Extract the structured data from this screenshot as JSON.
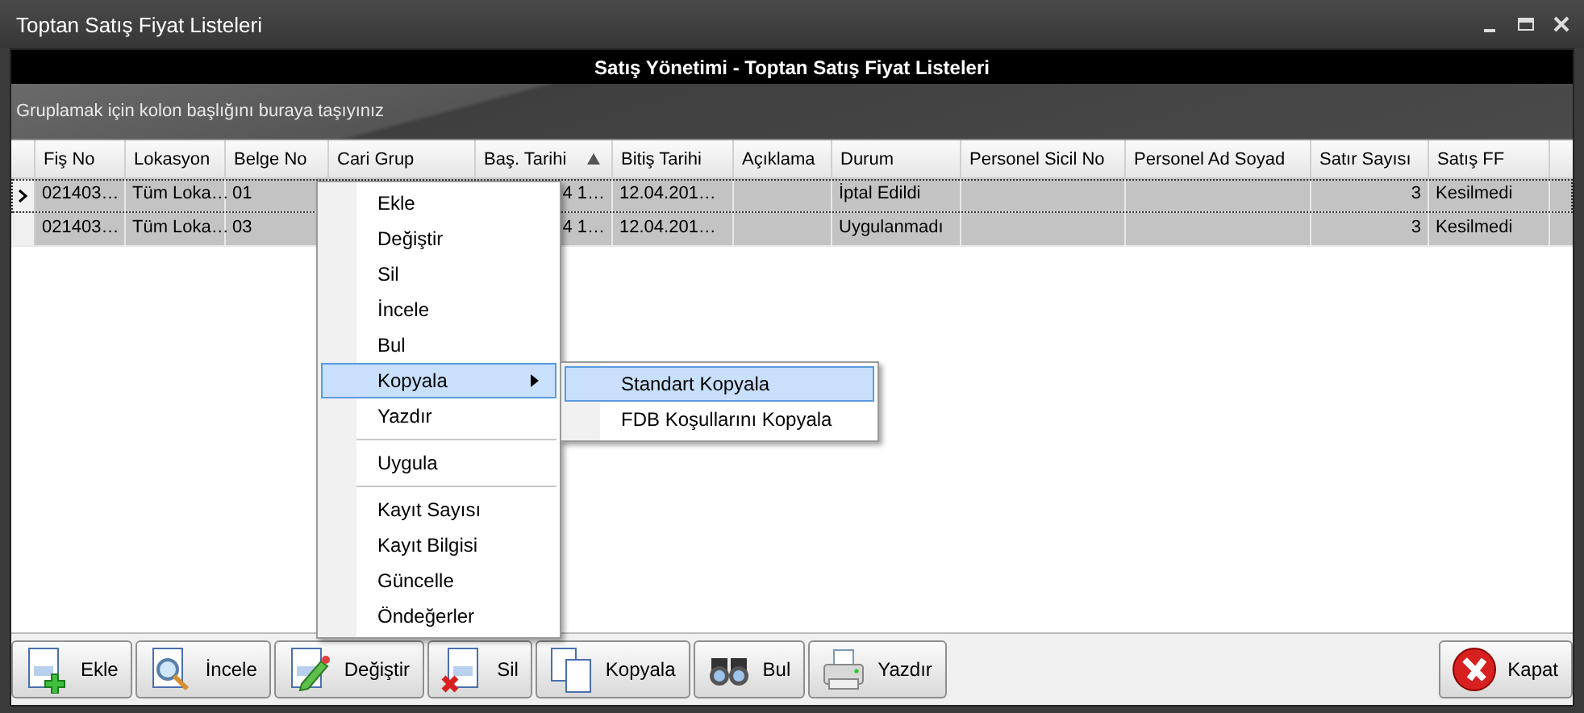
{
  "window": {
    "title": "Toptan Satış Fiyat Listeleri"
  },
  "header": "Satış Yönetimi - Toptan Satış Fiyat Listeleri",
  "group_hint": "Gruplamak için kolon başlığını buraya taşıyınız",
  "table": {
    "columns": [
      {
        "label": "Fiş No",
        "sorted": false
      },
      {
        "label": "Lokasyon",
        "sorted": false
      },
      {
        "label": "Belge No",
        "sorted": false
      },
      {
        "label": "Cari Grup",
        "sorted": false
      },
      {
        "label": "Baş. Tarihi",
        "sorted": true
      },
      {
        "label": "Bitiş Tarihi",
        "sorted": false
      },
      {
        "label": "Açıklama",
        "sorted": false
      },
      {
        "label": "Durum",
        "sorted": false
      },
      {
        "label": "Personel Sicil No",
        "sorted": false
      },
      {
        "label": "Personel Ad Soyad",
        "sorted": false
      },
      {
        "label": "Satır Sayısı",
        "sorted": false
      },
      {
        "label": "Satış FF",
        "sorted": false
      }
    ],
    "rows": [
      {
        "selected": true,
        "cells": [
          "021403…",
          "Tüm Loka…",
          "01",
          null,
          "4 1…",
          "12.04.201…",
          null,
          "İptal Edildi",
          null,
          null,
          "3",
          "Kesilmedi"
        ]
      },
      {
        "selected": false,
        "cells": [
          "021403…",
          "Tüm Loka…",
          "03",
          null,
          "4 1…",
          "12.04.201…",
          null,
          "Uygulanmadı",
          null,
          null,
          "3",
          "Kesilmedi"
        ]
      }
    ]
  },
  "context_menu": {
    "groups": [
      [
        {
          "label": "Ekle",
          "selected": false
        },
        {
          "label": "Değiştir",
          "selected": false
        },
        {
          "label": "Sil",
          "selected": false
        },
        {
          "label": "İncele",
          "selected": false
        },
        {
          "label": "Bul",
          "selected": false
        },
        {
          "label": "Kopyala",
          "selected": true,
          "submenu": [
            {
              "label": "Standart Kopyala",
              "selected": true
            },
            {
              "label": "FDB Koşullarını Kopyala",
              "selected": false
            }
          ]
        },
        {
          "label": "Yazdır",
          "selected": false
        }
      ],
      [
        {
          "label": "Uygula",
          "selected": false
        }
      ],
      [
        {
          "label": "Kayıt Sayısı",
          "selected": false
        },
        {
          "label": "Kayıt Bilgisi",
          "selected": false
        },
        {
          "label": "Güncelle",
          "selected": false
        },
        {
          "label": "Öndeğerler",
          "selected": false
        }
      ]
    ]
  },
  "toolbar": [
    {
      "kind": "add",
      "label": "Ekle"
    },
    {
      "kind": "view",
      "label": "İncele"
    },
    {
      "kind": "edit",
      "label": "Değiştir"
    },
    {
      "kind": "delete",
      "label": "Sil"
    },
    {
      "kind": "copy",
      "label": "Kopyala"
    },
    {
      "kind": "find",
      "label": "Bul"
    },
    {
      "kind": "print",
      "label": "Yazdır"
    }
  ],
  "close_button": {
    "kind": "close",
    "label": "Kapat"
  }
}
